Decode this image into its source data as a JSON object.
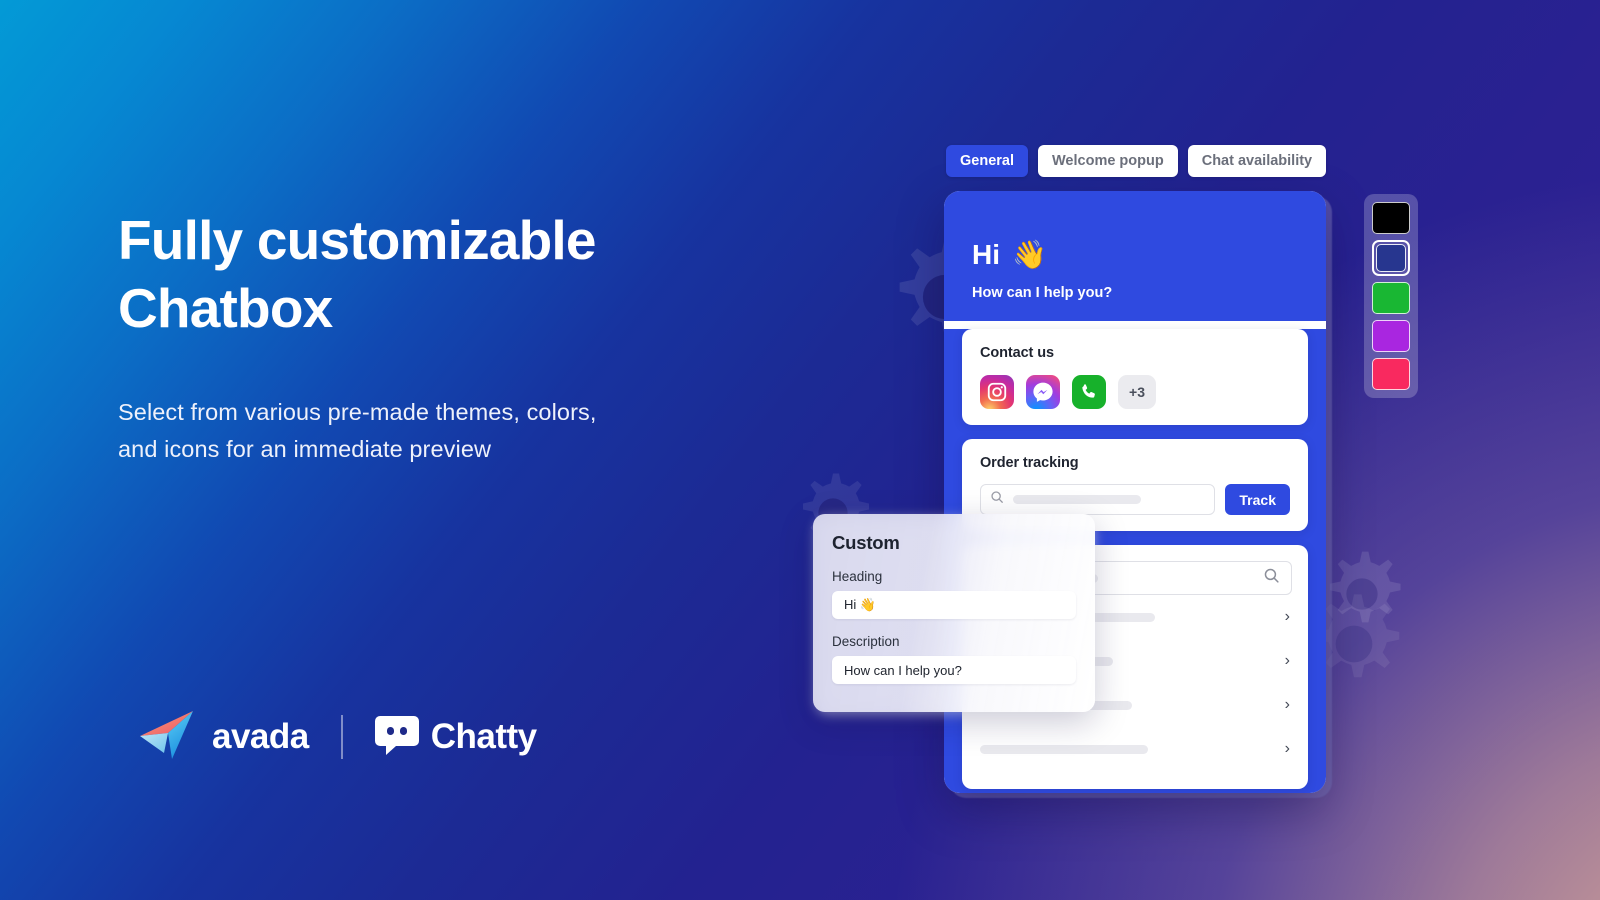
{
  "hero": {
    "headline_line1": "Fully customizable",
    "headline_line2": "Chatbox",
    "subhead_line1": "Select from various pre-made themes, colors,",
    "subhead_line2": "and icons for an immediate preview"
  },
  "brand": {
    "avada_label": "avada",
    "chatty_label": "Chatty"
  },
  "tabs": [
    {
      "label": "General",
      "active": true
    },
    {
      "label": "Welcome popup",
      "active": false
    },
    {
      "label": "Chat availability",
      "active": false
    }
  ],
  "chatbox": {
    "greeting": "Hi",
    "greeting_emoji": "👋",
    "subtitle": "How can I help you?",
    "contact": {
      "title": "Contact us",
      "icons": [
        "instagram-icon",
        "messenger-icon",
        "phone-icon"
      ],
      "more_label": "+3"
    },
    "tracking": {
      "title": "Order tracking",
      "input_placeholder": "",
      "button_label": "Track"
    },
    "faq": {
      "search_placeholder": "",
      "items": 4
    }
  },
  "custom_panel": {
    "title": "Custom",
    "heading_label": "Heading",
    "heading_value": "Hi 👋",
    "description_label": "Description",
    "description_value": "How can I help you?"
  },
  "palette": {
    "swatches": [
      {
        "name": "black",
        "color": "#000000",
        "selected": false
      },
      {
        "name": "navy",
        "color": "#27368f",
        "selected": true
      },
      {
        "name": "green",
        "color": "#19b733",
        "selected": false
      },
      {
        "name": "purple",
        "color": "#a926e0",
        "selected": false
      },
      {
        "name": "pink",
        "color": "#f9295f",
        "selected": false
      }
    ]
  },
  "theme": {
    "accent": "#2f4ae0",
    "bg_start": "#039ad6",
    "bg_end": "#2f1f95"
  }
}
